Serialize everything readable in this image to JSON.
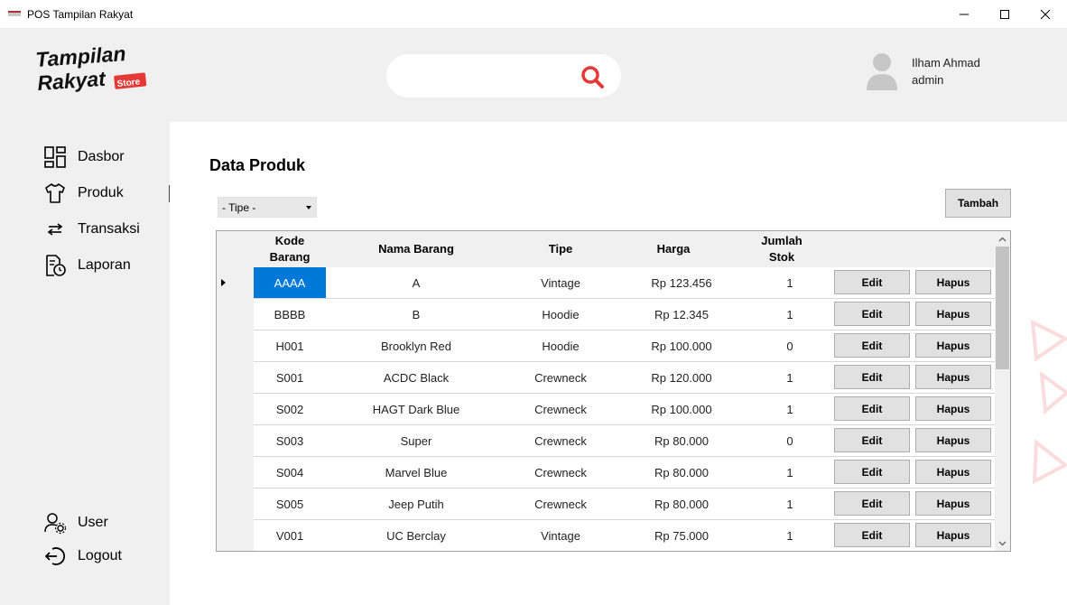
{
  "window": {
    "title": "POS Tampilan Rakyat"
  },
  "header": {
    "logo": {
      "line1": "Tampilan",
      "line2": "Rakyat",
      "badge": "Store"
    },
    "search": {
      "value": "",
      "placeholder": ""
    },
    "user": {
      "name": "Ilham Ahmad",
      "role": "admin"
    }
  },
  "sidebar": {
    "items": [
      {
        "label": "Dasbor",
        "icon": "dashboard-icon"
      },
      {
        "label": "Produk",
        "icon": "shirt-icon"
      },
      {
        "label": "Transaksi",
        "icon": "swap-arrows-icon"
      },
      {
        "label": "Laporan",
        "icon": "report-clock-icon"
      }
    ],
    "active": "Produk",
    "bottom_items": [
      {
        "label": "User",
        "icon": "user-settings-icon"
      },
      {
        "label": "Logout",
        "icon": "logout-icon"
      }
    ]
  },
  "main": {
    "title": "Data Produk",
    "filter": {
      "selected": "- Tipe -"
    },
    "add_button": "Tambah",
    "table": {
      "columns": [
        "Kode\nBarang",
        "Nama Barang",
        "Tipe",
        "Harga",
        "Jumlah\nStok"
      ],
      "edit_label": "Edit",
      "delete_label": "Hapus",
      "rows": [
        {
          "kode": "AAAA",
          "nama": "A",
          "tipe": "Vintage",
          "harga": "Rp 123.456",
          "stok": "1"
        },
        {
          "kode": "BBBB",
          "nama": "B",
          "tipe": "Hoodie",
          "harga": "Rp 12.345",
          "stok": "1"
        },
        {
          "kode": "H001",
          "nama": "Brooklyn Red",
          "tipe": "Hoodie",
          "harga": "Rp 100.000",
          "stok": "0"
        },
        {
          "kode": "S001",
          "nama": "ACDC Black",
          "tipe": "Crewneck",
          "harga": "Rp 120.000",
          "stok": "1"
        },
        {
          "kode": "S002",
          "nama": "HAGT Dark Blue",
          "tipe": "Crewneck",
          "harga": "Rp 100.000",
          "stok": "1"
        },
        {
          "kode": "S003",
          "nama": "Super",
          "tipe": "Crewneck",
          "harga": "Rp 80.000",
          "stok": "0"
        },
        {
          "kode": "S004",
          "nama": "Marvel Blue",
          "tipe": "Crewneck",
          "harga": "Rp 80.000",
          "stok": "1"
        },
        {
          "kode": "S005",
          "nama": "Jeep Putih",
          "tipe": "Crewneck",
          "harga": "Rp 80.000",
          "stok": "1"
        },
        {
          "kode": "V001",
          "nama": "UC Berclay",
          "tipe": "Vintage",
          "harga": "Rp 75.000",
          "stok": "1"
        }
      ],
      "selected_row": 0
    }
  },
  "colors": {
    "accent_red": "#e53935",
    "selection_blue": "#0078d7",
    "panel_gray": "#f0f0f0"
  }
}
